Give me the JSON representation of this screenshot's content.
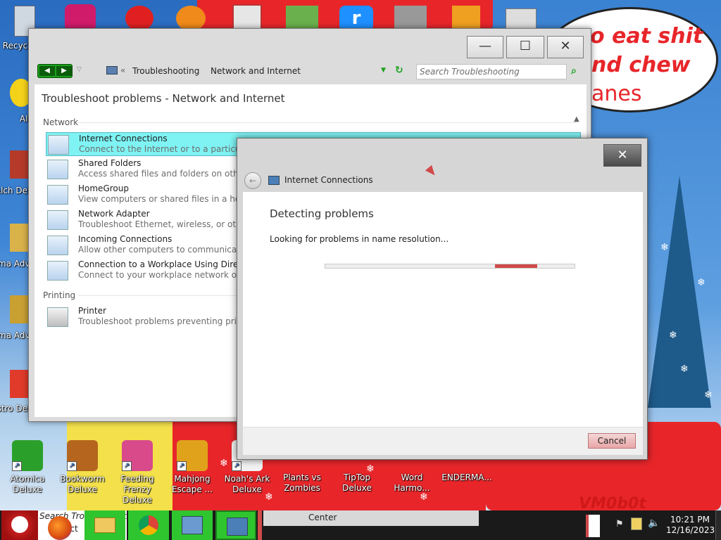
{
  "desktop": {
    "icons_left": [
      {
        "label": "Recycle",
        "icon": "recycle-bin-icon"
      },
      {
        "label": "AIM",
        "icon": "aim-icon"
      },
      {
        "label": "Alch Delu",
        "icon": "alchemy-icon"
      },
      {
        "label": "Ama Adve",
        "icon": "amazing-adventures-icon"
      },
      {
        "label": "Ama Adve",
        "icon": "amazing-adventures-2-icon"
      },
      {
        "label": "Astro Delu",
        "icon": "astro-icon"
      }
    ],
    "icons_bottom": [
      {
        "label": "Atomica Deluxe",
        "icon": "atomica-icon",
        "color": "#2aa02a"
      },
      {
        "label": "Bookworm Deluxe",
        "icon": "bookworm-icon",
        "color": "#b5651d"
      },
      {
        "label": "Feeding Frenzy Deluxe",
        "icon": "feeding-frenzy-icon",
        "color": "#d84a8a"
      },
      {
        "label": "Mahjong Escape ...",
        "icon": "mahjong-icon",
        "color": "#e0a21a"
      },
      {
        "label": "Noah's Ark Deluxe",
        "icon": "noahs-ark-icon",
        "color": "#ffffff"
      },
      {
        "label": "Plants vs Zombies",
        "icon": "plants-vs-zombies-icon",
        "color": "#e8262a"
      },
      {
        "label": "TipTop Deluxe",
        "icon": "tiptop-icon",
        "color": "#e8262a"
      },
      {
        "label": "Word Harmo...",
        "icon": "word-harmony-icon",
        "color": "#e8262a"
      },
      {
        "label": "ENDERMA...",
        "icon": "enderman-icon",
        "color": "#e8262a"
      }
    ],
    "speech_text_line1": "o eat shit",
    "speech_text_line2": "nd chew",
    "speech_text_line3": "anes",
    "watermark": "VM0b0t"
  },
  "cp_window": {
    "nav": {
      "breadcrumb_1": "Troubleshooting",
      "breadcrumb_2": "Network and Internet",
      "search_placeholder": "Search Troubleshooting"
    },
    "title": "Troubleshoot problems - Network and Internet",
    "section_network": "Network",
    "section_printing": "Printing",
    "items": [
      {
        "title": "Internet Connections",
        "desc": "Connect to the Internet or to a particular website."
      },
      {
        "title": "Shared Folders",
        "desc": "Access shared files and folders on other computers."
      },
      {
        "title": "HomeGroup",
        "desc": "View computers or shared files in a homegroup."
      },
      {
        "title": "Network Adapter",
        "desc": "Troubleshoot Ethernet, wireless, or other network adapters."
      },
      {
        "title": "Incoming Connections",
        "desc": "Allow other computers to communicate with this computer."
      },
      {
        "title": "Connection to a Workplace Using DirectAccess",
        "desc": "Connect to your workplace network over the Internet."
      }
    ],
    "printer": {
      "title": "Printer",
      "desc": "Troubleshoot problems preventing printing from completing."
    }
  },
  "dialog": {
    "header_title": "Internet Connections",
    "heading": "Detecting problems",
    "status": "Looking for problems in name resolution...",
    "progress": 0.85,
    "cancel_label": "Cancel",
    "close_glyph": "✕"
  },
  "taskbar": {
    "search_text": "Search Troubleshooting",
    "search_text_2": "ect",
    "center_label": "Center",
    "time": "10:21 PM",
    "date": "12/16/2023"
  },
  "colors": {
    "selection": "#7ff3f3",
    "progress_red": "#d04a4a",
    "nav_green": "#1aa01a",
    "taskbar_green": "#2ec52e"
  }
}
